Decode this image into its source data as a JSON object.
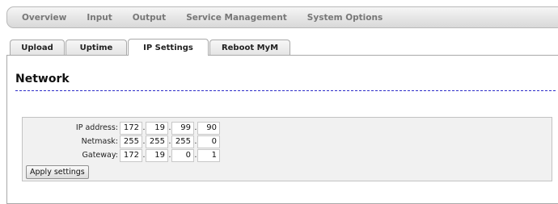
{
  "topnav": {
    "items": [
      {
        "label": "Overview"
      },
      {
        "label": "Input"
      },
      {
        "label": "Output"
      },
      {
        "label": "Service Management"
      },
      {
        "label": "System Options"
      }
    ]
  },
  "tabs": [
    {
      "label": "Upload",
      "active": false
    },
    {
      "label": "Uptime",
      "active": false
    },
    {
      "label": "IP Settings",
      "active": true
    },
    {
      "label": "Reboot MyM",
      "active": false
    }
  ],
  "section": {
    "title": "Network"
  },
  "network": {
    "ip": {
      "label": "IP address:",
      "octets": [
        "172",
        "19",
        "99",
        "90"
      ]
    },
    "netmask": {
      "label": "Netmask:",
      "octets": [
        "255",
        "255",
        "255",
        "0"
      ]
    },
    "gateway": {
      "label": "Gateway:",
      "octets": [
        "172",
        "19",
        "0",
        "1"
      ]
    },
    "separator": "."
  },
  "apply_button": {
    "label": "Apply settings"
  },
  "colors": {
    "title_rule": "#2d2dc8",
    "nav_text": "#777777",
    "box_background": "#f1f1f1"
  }
}
